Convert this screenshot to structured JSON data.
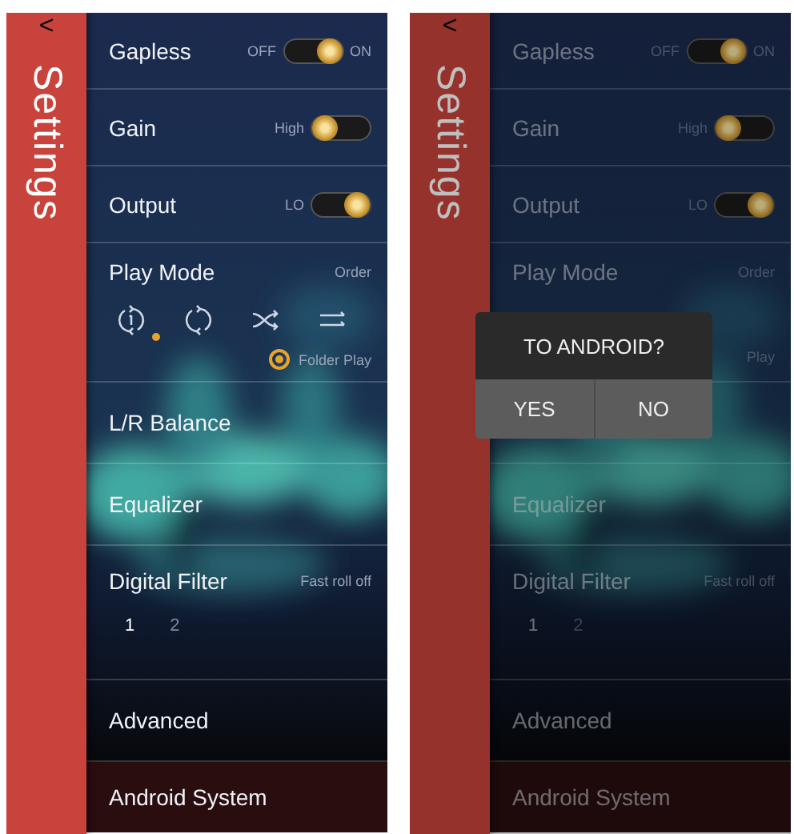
{
  "screens": [
    {
      "back": "<",
      "title": "Settings",
      "dimmed": false,
      "rows": [
        {
          "kind": "toggle",
          "label": "Gapless",
          "off_text": "OFF",
          "on_text": "ON",
          "on": true
        },
        {
          "kind": "toggle",
          "label": "Gain",
          "off_text": "High",
          "on": false
        },
        {
          "kind": "toggle",
          "label": "Output",
          "off_text": "LO",
          "on": true
        },
        {
          "kind": "playmode",
          "label": "Play Mode",
          "value": "Order",
          "modes": [
            {
              "selected": true
            },
            {
              "selected": false
            },
            {
              "selected": false
            },
            {
              "selected": false
            }
          ],
          "folder": {
            "label": "Folder Play",
            "checked": true
          }
        },
        {
          "kind": "plain",
          "label": "L/R Balance"
        },
        {
          "kind": "plain",
          "label": "Equalizer"
        },
        {
          "kind": "filter",
          "label": "Digital Filter",
          "value": "Fast roll off",
          "options": [
            {
              "label": "1",
              "selected": true
            },
            {
              "label": "2",
              "selected": false
            }
          ]
        },
        {
          "kind": "plain",
          "label": "Advanced"
        },
        {
          "kind": "footer",
          "label": "Android System"
        }
      ]
    },
    {
      "back": "<",
      "title": "Settings",
      "dimmed": true,
      "rows": [
        {
          "kind": "toggle",
          "label": "Gapless",
          "off_text": "OFF",
          "on_text": "ON",
          "on": true
        },
        {
          "kind": "toggle",
          "label": "Gain",
          "off_text": "High",
          "on": false
        },
        {
          "kind": "toggle",
          "label": "Output",
          "off_text": "LO",
          "on": true
        },
        {
          "kind": "playmode",
          "label": "Play Mode",
          "value": "Order",
          "modes": [],
          "folder": {
            "label": "Play"
          }
        },
        {
          "kind": "plain"
        },
        {
          "kind": "plain",
          "label": "Equalizer"
        },
        {
          "kind": "filter",
          "label": "Digital Filter",
          "value": "Fast roll off",
          "options": [
            {
              "label": "1",
              "selected": true
            },
            {
              "label": "2",
              "selected": false
            }
          ]
        },
        {
          "kind": "plain",
          "label": "Advanced"
        },
        {
          "kind": "footer",
          "label": "Android System"
        }
      ],
      "dialog": {
        "title": "TO ANDROID?",
        "buttons": [
          "YES",
          "NO"
        ]
      }
    }
  ]
}
